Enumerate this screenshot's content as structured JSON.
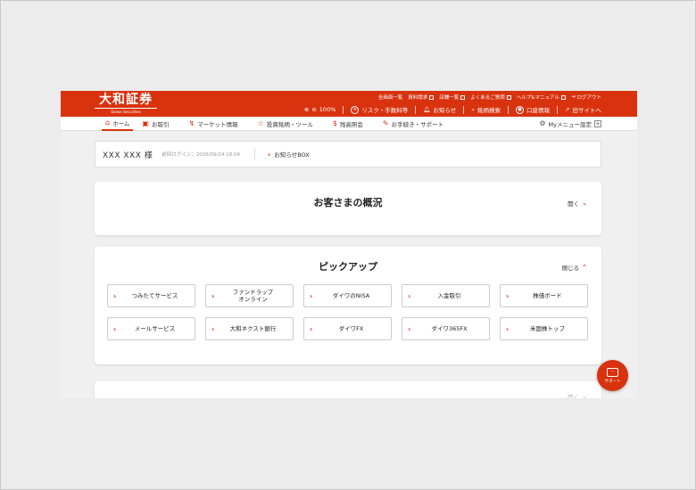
{
  "header": {
    "logo_ja": "大和証券",
    "logo_en": "Daiwa Securities",
    "links": [
      "全画面一覧",
      "資料請求",
      "店舗一覧",
      "よくあるご質問",
      "ヘルプ&マニュアル",
      "ログアウト"
    ],
    "zoom": "100%",
    "risk": "リスク・手数料等",
    "news": "お知らせ",
    "search": "銘柄検索",
    "account": "口座情報",
    "oldsite": "旧サイトへ"
  },
  "nav": {
    "items": [
      "ホーム",
      "お取引",
      "マーケット情報",
      "投資銘柄・ツール",
      "残高照会",
      "お手続き・サポート"
    ],
    "mymenu": "Myメニュー設定"
  },
  "user": {
    "name": "XXX XXX 様",
    "last_login": "前回ログイン：2026/09/24 18:04",
    "box": "お知らせBOX"
  },
  "overview": {
    "title": "お客さまの概況",
    "toggle": "開く"
  },
  "pickup": {
    "title": "ピックアップ",
    "toggle": "閉じる",
    "tiles": [
      "つみたてサービス",
      "ファンドラップ\nオンライン",
      "ダイワのNISA",
      "入金取引",
      "株価ボード",
      "メールサービス",
      "大和ネクスト銀行",
      "ダイワFX",
      "ダイワ365FX",
      "米国株トップ"
    ]
  },
  "third": {
    "toggle": "開く"
  },
  "fab": {
    "label": "サポート"
  }
}
